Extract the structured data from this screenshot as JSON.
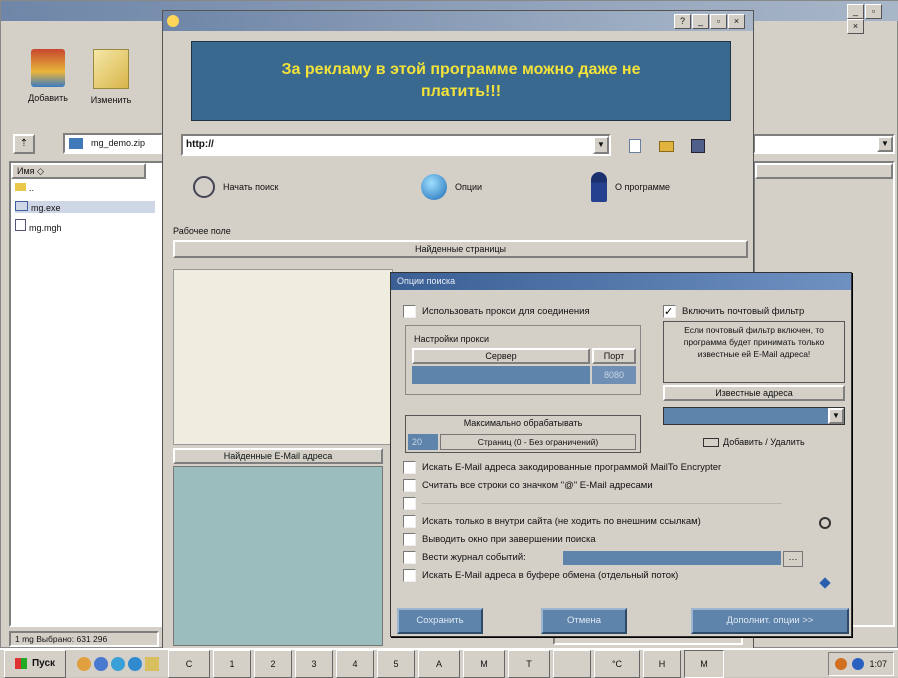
{
  "browser_window": {
    "toolbar": {
      "add_label": "Добавить",
      "edit_label": "Изменить"
    },
    "address_value": "mg_demo.zip",
    "column_header": "Имя",
    "files": [
      "..",
      "mg.exe",
      "mg.mgh"
    ],
    "status_text": "1 mg  Выбрано: 631 296"
  },
  "app_window": {
    "ad_text": "За рекламу в этой программе можно даже не платить!!!",
    "url_value": "http://",
    "search_label": "Начать поиск",
    "options_label": "Опции",
    "about_label": "О программе",
    "workfield_label": "Рабочее поле",
    "found_pages_header": "Найденные страницы",
    "found_emails_header": "Найденные E-Mail адреса"
  },
  "dialog": {
    "title": "Опции поиска",
    "use_proxy": "Использовать прокси для соединения",
    "proxy_settings": "Настройки прокси",
    "server_col": "Сервер",
    "port_col": "Порт",
    "port_value": "8080",
    "mail_filter": "Включить почтовый фильтр",
    "mail_filter_note": "Если почтовый фильтр включен, то программа будет принимать только известные ей E-Mail адреса!",
    "known_addresses": "Известные адреса",
    "add_remove": "Добавить / Удалить",
    "max_process_label": "Максимально обрабатывать",
    "max_process_value": "20",
    "max_process_note": "Страниц (0 - Без ограничений)",
    "options": [
      {
        "label": "Искать E-Mail адреса закодированные программой MailTo Encrypter",
        "checked": false
      },
      {
        "label": "Считать все строки со значком \"@\" E-Mail адресами",
        "checked": false
      },
      {
        "label": "",
        "checked": false
      },
      {
        "label": "Искать только в внутри сайта (не ходить по внешним ссылкам)",
        "checked": false
      },
      {
        "label": "Выводить окно при завершении поиска",
        "checked": false
      },
      {
        "label": "Вести журнал событий:",
        "checked": false
      },
      {
        "label": "Искать E-Mail адреса в буфере обмена (отдельный поток)",
        "checked": false
      }
    ],
    "save_btn": "Сохранить",
    "cancel_btn": "Отмена",
    "more_btn": "Дополнит. опции >>"
  },
  "taskbar": {
    "start_label": "Пуск",
    "clock": "1:07",
    "tasks": [
      "С",
      "1",
      "2",
      "3",
      "4",
      "5",
      "А",
      "М",
      "Т",
      "",
      "°С",
      "Н",
      "М"
    ]
  },
  "colors": {
    "accent": "#5f84ab",
    "ad_banner": "#3a6990",
    "ad_text": "#f2e23a"
  }
}
